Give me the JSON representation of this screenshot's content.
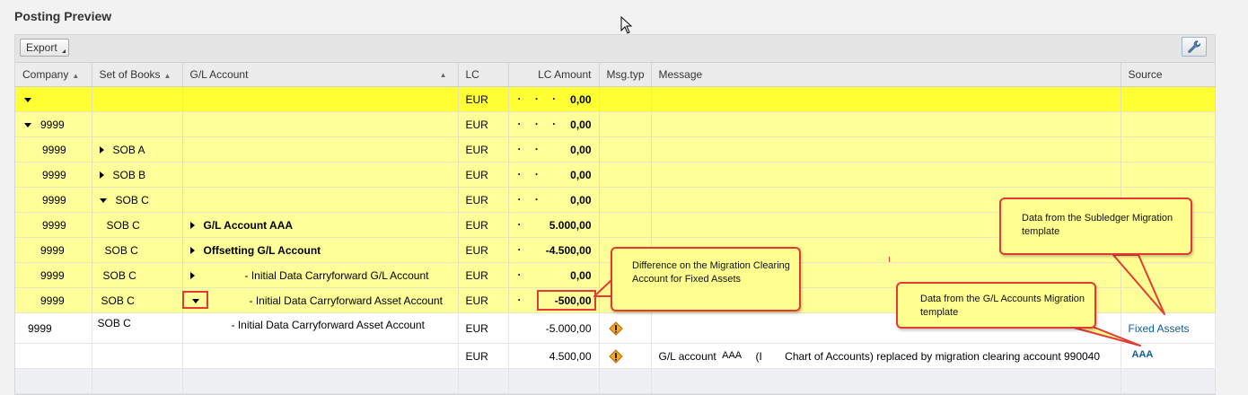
{
  "page": {
    "title": "Posting Preview"
  },
  "toolbar": {
    "export_label": "Export"
  },
  "columns": [
    {
      "key": "company",
      "label": "Company",
      "sortable": true
    },
    {
      "key": "sob",
      "label": "Set of Books",
      "sortable": true
    },
    {
      "key": "gl",
      "label": "G/L Account",
      "sortable": true
    },
    {
      "key": "lc",
      "label": "LC",
      "sortable": false
    },
    {
      "key": "amount",
      "label": "LC Amount",
      "sortable": false
    },
    {
      "key": "msgtyp",
      "label": "Msg.typ",
      "sortable": false
    },
    {
      "key": "message",
      "label": "Message",
      "sortable": false
    },
    {
      "key": "source",
      "label": "Source",
      "sortable": false
    }
  ],
  "rows": [
    {
      "company": "",
      "sob": "",
      "gl": "",
      "lc": "EUR",
      "amount": "0,00",
      "level_dots": "· · · ·"
    },
    {
      "company": "9999",
      "sob": "",
      "gl": "",
      "lc": "EUR",
      "amount": "0,00",
      "level_dots": "· · ·"
    },
    {
      "company": "9999",
      "sob": "SOB A",
      "gl": "",
      "lc": "EUR",
      "amount": "0,00",
      "level_dots": "· ·"
    },
    {
      "company": "9999",
      "sob": "SOB B",
      "gl": "",
      "lc": "EUR",
      "amount": "0,00",
      "level_dots": "· ·"
    },
    {
      "company": "9999",
      "sob": "SOB C",
      "gl": "",
      "lc": "EUR",
      "amount": "0,00",
      "level_dots": "· ·"
    },
    {
      "company": "9999",
      "sob": "SOB C",
      "gl": "G/L Account AAA",
      "lc": "EUR",
      "amount": "5.000,00",
      "level_dots": "·"
    },
    {
      "company": "9999",
      "sob": "SOB C",
      "gl": "Offsetting G/L Account",
      "lc": "EUR",
      "amount": "-4.500,00",
      "level_dots": "·"
    },
    {
      "company": "9999",
      "sob": "SOB C",
      "gl": "- Initial Data Carryforward G/L Account",
      "lc": "EUR",
      "amount": "0,00",
      "level_dots": "·"
    },
    {
      "company": "9999",
      "sob": "SOB C",
      "gl": "- Initial Data Carryforward Asset Account",
      "lc": "EUR",
      "amount": "-500,00",
      "level_dots": "·"
    },
    {
      "company": "9999",
      "sob": "SOB C",
      "gl": "- Initial Data Carryforward Asset Account",
      "lc": "EUR",
      "amount": "-5.000,00",
      "message": "",
      "source": "Fixed Assets"
    },
    {
      "company": "",
      "sob": "",
      "gl": "",
      "lc": "EUR",
      "amount": "4.500,00",
      "message_parts": {
        "a": "G/L account",
        "b": "AAA",
        "c": "(I",
        "d": "Chart of Accounts) replaced by migration clearing account 990040"
      },
      "source": "AAA"
    }
  ],
  "callouts": {
    "difference": "Difference on the Migration Clearing Account for Fixed Assets",
    "subledger": "Data from the Subledger Migration template",
    "gl_accounts": "Data from the G/L Accounts Migration template"
  },
  "colors": {
    "highlight": "#e53935",
    "callout_bg": "#ffff8f",
    "row_yellow": "#ffff99",
    "row_header": "#ffff33",
    "link": "#0a5fa0"
  }
}
